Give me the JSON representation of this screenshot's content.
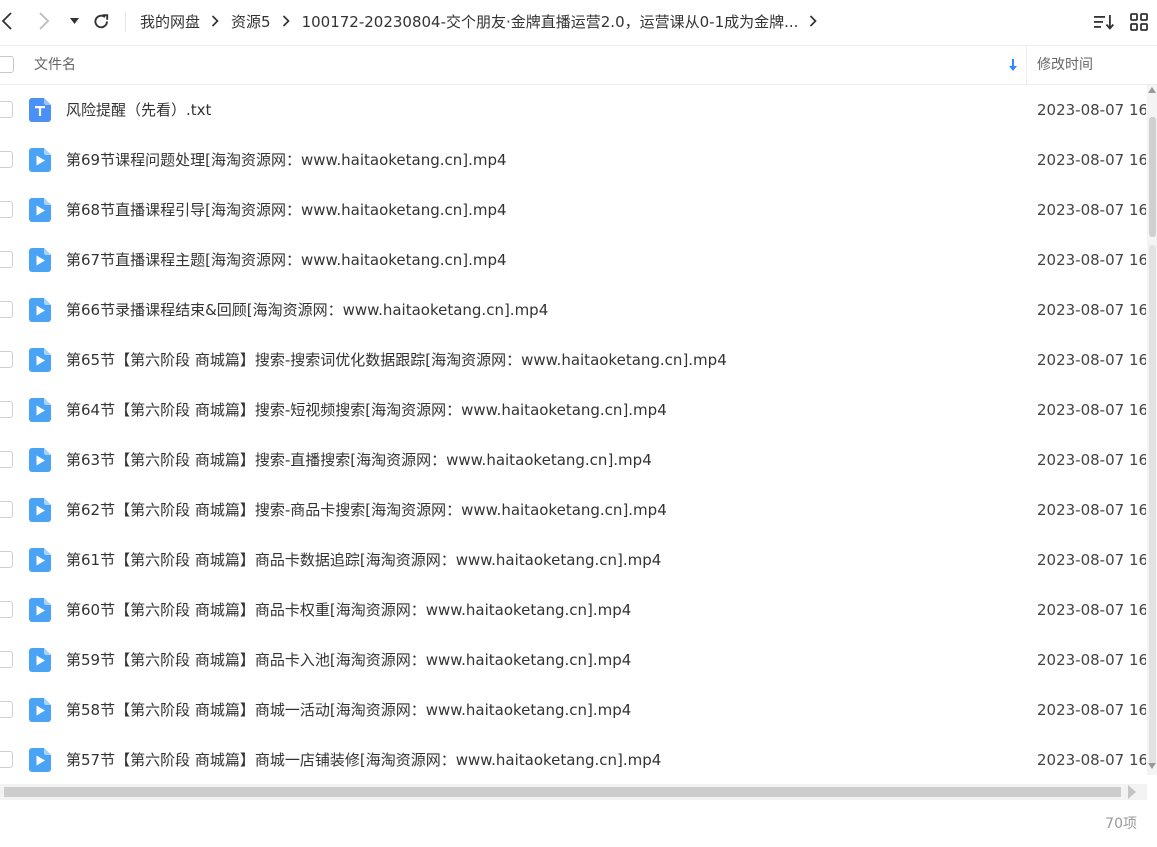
{
  "toolbar": {
    "icons": [
      "chevron-left-icon",
      "chevron-right-icon",
      "caret-down-icon",
      "refresh-icon",
      "sort-icon",
      "grid-view-icon"
    ],
    "breadcrumb": [
      "我的网盘",
      "资源5",
      "100172-20230804-交个朋友·金牌直播运营2.0，运营课从0-1成为金牌..."
    ]
  },
  "header": {
    "name_label": "文件名",
    "time_label": "修改时间"
  },
  "files": [
    {
      "name": "风险提醒（先看）.txt",
      "time": "2023-08-07 16",
      "type": "txt"
    },
    {
      "name": "第69节课程问题处理[海淘资源网：www.haitaoketang.cn].mp4",
      "time": "2023-08-07 16",
      "type": "video"
    },
    {
      "name": "第68节直播课程引导[海淘资源网：www.haitaoketang.cn].mp4",
      "time": "2023-08-07 16",
      "type": "video"
    },
    {
      "name": "第67节直播课程主题[海淘资源网：www.haitaoketang.cn].mp4",
      "time": "2023-08-07 16",
      "type": "video"
    },
    {
      "name": "第66节录播课程结束&回顾[海淘资源网：www.haitaoketang.cn].mp4",
      "time": "2023-08-07 16",
      "type": "video"
    },
    {
      "name": "第65节【第六阶段 商城篇】搜索-搜索词优化数据跟踪[海淘资源网：www.haitaoketang.cn].mp4",
      "time": "2023-08-07 16",
      "type": "video"
    },
    {
      "name": "第64节【第六阶段 商城篇】搜索-短视频搜索[海淘资源网：www.haitaoketang.cn].mp4",
      "time": "2023-08-07 16",
      "type": "video"
    },
    {
      "name": "第63节【第六阶段 商城篇】搜索-直播搜索[海淘资源网：www.haitaoketang.cn].mp4",
      "time": "2023-08-07 16",
      "type": "video"
    },
    {
      "name": "第62节【第六阶段 商城篇】搜索-商品卡搜索[海淘资源网：www.haitaoketang.cn].mp4",
      "time": "2023-08-07 16",
      "type": "video"
    },
    {
      "name": "第61节【第六阶段 商城篇】商品卡数据追踪[海淘资源网：www.haitaoketang.cn].mp4",
      "time": "2023-08-07 16",
      "type": "video"
    },
    {
      "name": "第60节【第六阶段 商城篇】商品卡权重[海淘资源网：www.haitaoketang.cn].mp4",
      "time": "2023-08-07 16",
      "type": "video"
    },
    {
      "name": "第59节【第六阶段 商城篇】商品卡入池[海淘资源网：www.haitaoketang.cn].mp4",
      "time": "2023-08-07 16",
      "type": "video"
    },
    {
      "name": "第58节【第六阶段 商城篇】商城一活动[海淘资源网：www.haitaoketang.cn].mp4",
      "time": "2023-08-07 16",
      "type": "video"
    },
    {
      "name": "第57节【第六阶段 商城篇】商城一店铺装修[海淘资源网：www.haitaoketang.cn].mp4",
      "time": "2023-08-07 16",
      "type": "video"
    }
  ],
  "footer": {
    "count": "70项"
  },
  "colors": {
    "txt_icon": "#4a90f5",
    "video_icon": "#4aa3f5",
    "sort_arrow": "#2f88ff"
  }
}
